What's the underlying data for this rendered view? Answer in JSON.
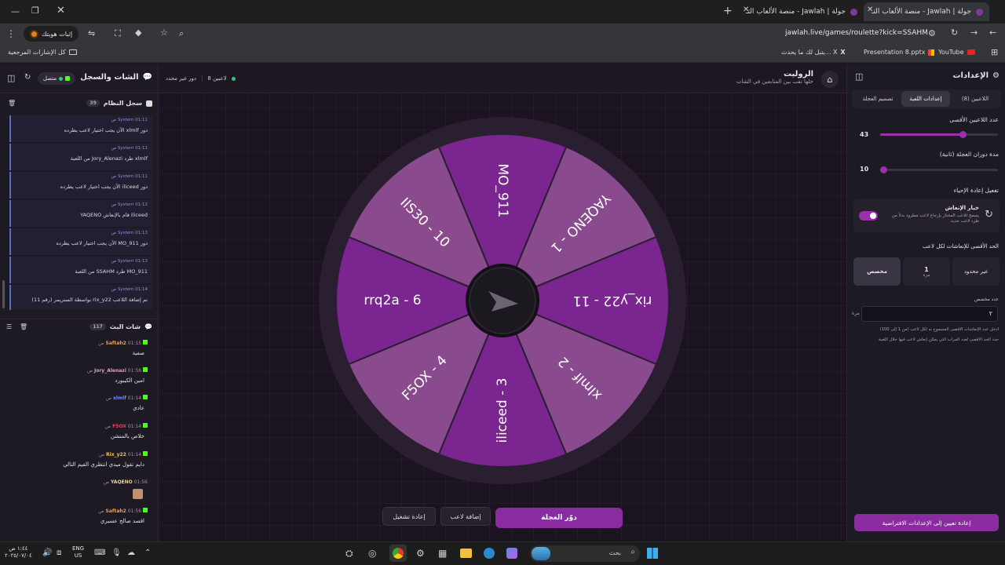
{
  "browser": {
    "tabs": [
      {
        "title": "جولة | Jawlah - منصة الألعاب التـ",
        "active": false
      },
      {
        "title": "جولة | Jawlah - منصة الألعاب التـ",
        "active": true
      }
    ],
    "url": "jawlah.live/games/roulette?kick=SSAHM",
    "profile_label": "إثبات هويتك",
    "bookmarks": {
      "all": "كل الإشارات المرجعية",
      "items": [
        "YouTube",
        "Presentation 8.pptx",
        "يتبل لك ما يحدث... X"
      ]
    }
  },
  "left_panel": {
    "title": "الشات والسجل",
    "status": "متصل",
    "system_log": {
      "title": "سجل النظام",
      "count": "39",
      "messages": [
        {
          "sender": "System",
          "time": "01:11 ص",
          "text": "دور xlmlf الآن يجب اختيار لاعب يطرده"
        },
        {
          "sender": "System",
          "time": "01:11 ص",
          "text": "xlmlf طرد Jory_Alenazi من اللعبة"
        },
        {
          "sender": "System",
          "time": "01:11 ص",
          "text": "دور iliceed الآن يجب اختيار لاعب يطرده"
        },
        {
          "sender": "System",
          "time": "01:12 ص",
          "text": "iliceed قام بالإنعاش YAQENO"
        },
        {
          "sender": "System",
          "time": "01:13 ص",
          "text": "دور MO_911 الآن يجب اختيار لاعب يطرده"
        },
        {
          "sender": "System",
          "time": "01:13 ص",
          "text": "MO_911 طرد SSAHM من اللعبة"
        },
        {
          "sender": "System",
          "time": "01:14 ص",
          "text": "تم إضافة اللاعب rix_y22 بواسطة الستريمر (رقم 11)"
        }
      ]
    },
    "live_chat": {
      "title": "شات البث",
      "count": "117",
      "messages": [
        {
          "user": "Saftah2",
          "time": "01:15 ص",
          "text": "صفية",
          "color": "#f0a040"
        },
        {
          "user": "Jory_Alenazi",
          "time": "01:56 ص",
          "text": "امين الكيبورد",
          "color": "#e0a0c0"
        },
        {
          "user": "xlmlf",
          "time": "01:14 ص",
          "text": "عادي",
          "color": "#6a8cff"
        },
        {
          "user": "F5OX",
          "time": "01:14 ص",
          "text": "خلاص بالمنشن",
          "color": "#e0405a"
        },
        {
          "user": "Rix_y22",
          "time": "01:14 ص",
          "text": "دايم تقول ميدي انتظري القيم التالي",
          "color": "#f0c060"
        },
        {
          "user": "YAQENO",
          "time": "01:56 ص",
          "text": "",
          "color": "#f0d090"
        },
        {
          "user": "Saftah2",
          "time": "01:56 ص",
          "text": "اقصد صالح عسيري",
          "color": "#f0a040"
        }
      ]
    }
  },
  "header": {
    "title": "الروليت",
    "subtitle": "خلها تقب بين المتابعين في الشات",
    "players_badge": "8 لاعبين",
    "mode": "دور غير محدد"
  },
  "wheel": {
    "segments": [
      {
        "label": "MO_911",
        "color": "#7a2590"
      },
      {
        "label": "YAQENO - 1",
        "color": "#8a4a8e"
      },
      {
        "label": "rix_y22 - 11",
        "color": "#7a2590"
      },
      {
        "label": "xlmlf - 2",
        "color": "#8a4a8e"
      },
      {
        "label": "iliceed - 3",
        "color": "#7a2590"
      },
      {
        "label": "F5OX - 4",
        "color": "#8a4a8e"
      },
      {
        "label": "rrq2a - 6",
        "color": "#7a2590"
      },
      {
        "label": "IlS30 - 10",
        "color": "#8a4a8e"
      }
    ]
  },
  "actions": {
    "spin": "دوّر العجلة",
    "add_player": "إضافة لاعب",
    "restart": "إعادة تشغيل"
  },
  "settings": {
    "title": "الإعدادات",
    "tabs": [
      "اللاعبين (8)",
      "إعدادات اللعبة",
      "تصميم العجلة"
    ],
    "active_tab": 1,
    "max_players_label": "عدد اللاعبين الأقصى",
    "max_players_value": "43",
    "max_players_fraction": 0.7,
    "spin_duration_label": "مدة دوران العجلة (ثانية)",
    "spin_duration_value": "10",
    "spin_duration_fraction": 0.02,
    "revive_section": "تفعيل إعادة الإحياء",
    "revive_title": "خيار الإنعاش",
    "revive_desc": "يسمح للاعب المختار بإرجاع لاعب مطرود بدلاً من طرد لاعب جديد.",
    "max_revives_label": "الحد الأقصى للإنعاشات لكل لاعب",
    "options": [
      {
        "label": "غير محدود",
        "sub": ""
      },
      {
        "label": "1",
        "sub": "مرة"
      },
      {
        "label": "مخصص",
        "sub": ""
      }
    ],
    "custom_label": "عدد مخصص",
    "custom_value": "٢",
    "custom_unit": "مرة",
    "hint1": "أدخل عدد الإنعاشات الأقصى المسموح به لكل لاعب (من 1 إلى 100)",
    "hint2": "حدد الحد الأقصى لعدد المرات التي يمكن إنعاش لاعب فيها خلال اللعبة",
    "reset": "إعادة تعيين إلى الإعدادات الافتراضية",
    "accent": "#9b2fae"
  },
  "taskbar": {
    "search": "بحث",
    "lang": "ENG",
    "lang2": "US",
    "time": "١:٤٤ ص",
    "date": "٢٠٢٥/٠٧/٠٤"
  }
}
